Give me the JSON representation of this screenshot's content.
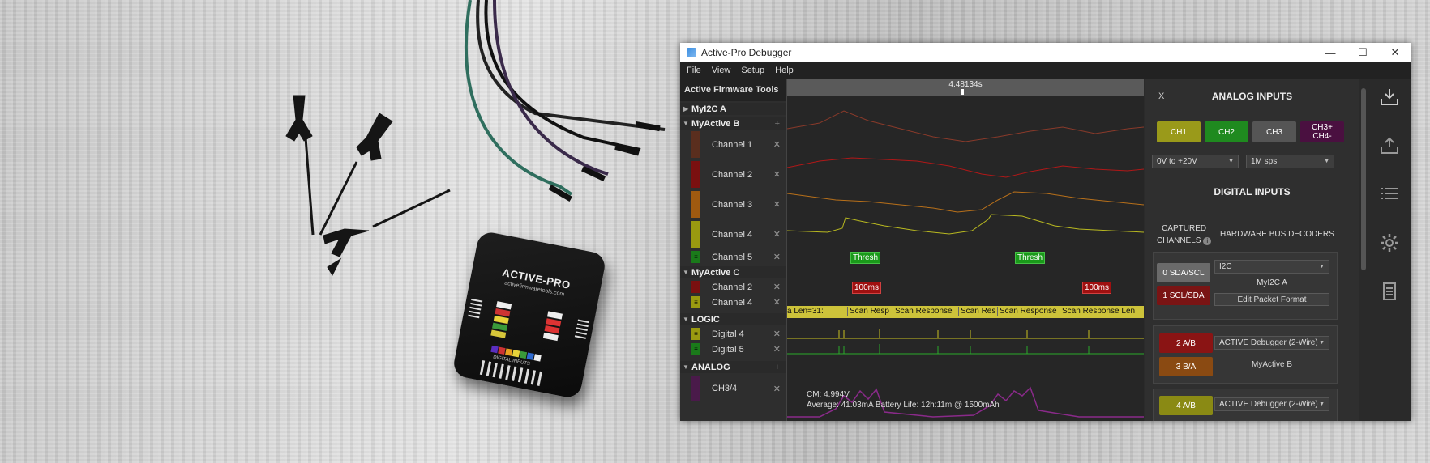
{
  "window": {
    "title": "Active-Pro Debugger",
    "minimize": "—",
    "maximize": "☐",
    "close": "✕"
  },
  "menu": [
    "File",
    "View",
    "Setup",
    "Help"
  ],
  "device": {
    "title": "ACTIVE-PRO",
    "url": "activefirmwaretools.com",
    "inputs_label": "DIGITAL INPUTS"
  },
  "left": {
    "header": "Active Firmware Tools",
    "groups": [
      {
        "name": "MyI2C A",
        "collapsed": true
      },
      {
        "name": "MyActive B"
      },
      {
        "name": "MyActive C"
      },
      {
        "name": "LOGIC"
      },
      {
        "name": "ANALOG"
      }
    ],
    "channels": [
      {
        "label": "Channel 1",
        "color": "#5a2e1e"
      },
      {
        "label": "Channel 2",
        "color": "#7a1010"
      },
      {
        "label": "Channel 3",
        "color": "#a05a10"
      },
      {
        "label": "Channel 4",
        "color": "#9a9a10"
      },
      {
        "label": "Channel 5",
        "color": "#1a7a1a"
      },
      {
        "label": "Channel 2",
        "color": "#7a1010"
      },
      {
        "label": "Channel 4",
        "color": "#9a9a10"
      },
      {
        "label": "Digital 4",
        "color": "#9a9a10"
      },
      {
        "label": "Digital 5",
        "color": "#1a7a1a"
      },
      {
        "label": "CH3/4",
        "color": "#4a1a4a"
      }
    ],
    "close_glyph": "✕",
    "add_glyph": "+",
    "collapsed_glyph": "▶",
    "expanded_glyph": "▼"
  },
  "timeline": {
    "cursor_time": "4.48134s"
  },
  "annotations": {
    "thresh": "Thresh",
    "ms": "100ms",
    "packets": [
      "a Len=31:",
      "Scan Resp",
      "Scan Response",
      "Scan Res",
      "Scan Response",
      "Scan Response Len"
    ],
    "cm": "CM: 4.994V",
    "avg": "Average: 41.03mA  Battery Life: 12h:11m @ 1500mAh"
  },
  "right": {
    "close": "X",
    "analog_title": "ANALOG INPUTS",
    "channels": [
      {
        "label": "CH1",
        "color": "#9a9a1a"
      },
      {
        "label": "CH2",
        "color": "#1f8a1f"
      },
      {
        "label": "CH3",
        "color": "#555555"
      },
      {
        "label": "CH3+\nCH4-",
        "color": "#4a1040"
      }
    ],
    "range": "0V to +20V",
    "rate": "1M sps",
    "digital_title": "DIGITAL INPUTS",
    "captured": "CAPTURED\nCHANNELS",
    "info": "i",
    "hw_decoders": "HARDWARE BUS DECODERS",
    "bus1": {
      "pin_a": "0 SDA/SCL",
      "pin_b": "1 SCL/SDA",
      "type": "I2C",
      "name": "MyI2C A",
      "edit": "Edit Packet Format"
    },
    "bus2": {
      "pin_a": "2 A/B",
      "pin_b": "3 B/A",
      "type": "ACTIVE Debugger (2-Wire)",
      "name": "MyActive B"
    },
    "bus3": {
      "pin_a": "4 A/B",
      "type": "ACTIVE Debugger (2-Wire)"
    },
    "dropdown_glyph": "▼"
  },
  "toolbar": [
    "download-icon",
    "upload-icon",
    "list-icon",
    "gear-icon",
    "document-icon"
  ]
}
